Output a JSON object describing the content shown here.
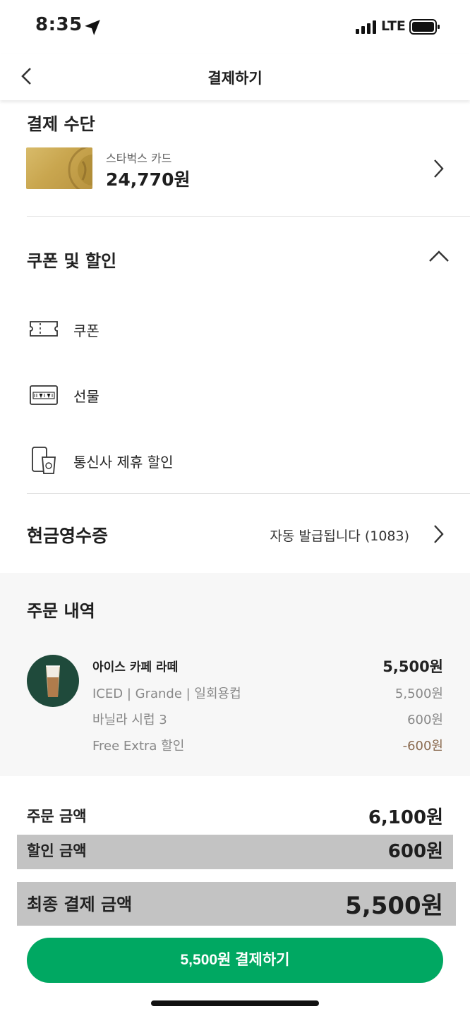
{
  "status": {
    "time": "8:35",
    "network": "LTE"
  },
  "nav": {
    "title": "결제하기"
  },
  "payment": {
    "section_title": "결제 수단",
    "card_name": "스타벅스 카드",
    "card_balance": "24,770원"
  },
  "coupons": {
    "section_title": "쿠폰 및 할인",
    "options": [
      {
        "label": "쿠폰",
        "icon": "ticket-icon"
      },
      {
        "label": "선물",
        "icon": "gift-card-icon"
      },
      {
        "label": "통신사 제휴 할인",
        "icon": "phone-cup-icon"
      }
    ]
  },
  "receipt": {
    "label": "현금영수증",
    "value": "자동 발급됩니다 (1083)"
  },
  "order": {
    "section_title": "주문 내역",
    "item": {
      "name": "아이스 카페 라떼",
      "price": "5,500원",
      "lines": [
        {
          "label": "ICED | Grande | 일회용컵",
          "price": "5,500원"
        },
        {
          "label": "바닐라 시럽 3",
          "price": "600원"
        },
        {
          "label": "Free Extra 할인",
          "price": "-600원"
        }
      ]
    }
  },
  "summary": {
    "order_amount_label": "주문 금액",
    "order_amount": "6,100원",
    "discount_label": "할인 금액",
    "discount": "600원",
    "final_label": "최종 결제 금액",
    "final": "5,500원"
  },
  "pay_button": {
    "label": "5,500원 결제하기"
  },
  "colors": {
    "accent": "#00a862",
    "discount": "#8a6a4f",
    "highlight": "#c3c3c3"
  }
}
